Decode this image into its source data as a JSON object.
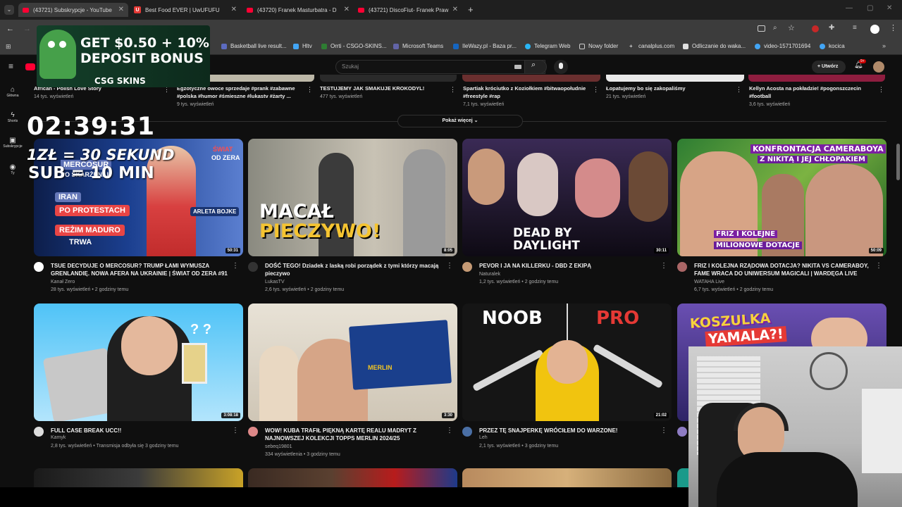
{
  "browser": {
    "tabs": [
      {
        "title": "(43721) Subskrypcje - YouTube"
      },
      {
        "title": "Best Food EVER | UwUFUFU",
        "icon_letter": "U"
      },
      {
        "title": "(43720) Franek Masturbatra - D"
      },
      {
        "title": "(43721) DiscoFiut- Franek Praw"
      }
    ],
    "new_tab": "+",
    "bookmarks": [
      {
        "label": "Basketball live result..."
      },
      {
        "label": "Hltv"
      },
      {
        "label": "Orrti - CSGO-SKINS..."
      },
      {
        "label": "Microsoft Teams"
      },
      {
        "label": "IleWazy.pl - Baza pr..."
      },
      {
        "label": "Telegram Web"
      },
      {
        "label": "Nowy folder"
      },
      {
        "label": "canalplus.com"
      },
      {
        "label": "Odliczanie do waka..."
      },
      {
        "label": "video-1571701694"
      },
      {
        "label": "kocica"
      }
    ]
  },
  "overlay": {
    "banner_line1": "GET $0.50 + 10%",
    "banner_line2": "DEPOSIT BONUS",
    "banner_brand": "CSG SKINS",
    "timer": "02:39:31",
    "line1": "1ZŁ = 30 SEKUND",
    "line2": "SUB = 10 MIN"
  },
  "youtube": {
    "search_placeholder": "Szukaj",
    "create_label": "Utwórz",
    "notif_count": "9+",
    "sidebar": [
      {
        "label": "Główna"
      },
      {
        "label": "Shorts"
      },
      {
        "label": "Subskrypcje"
      },
      {
        "label": "Ty"
      }
    ],
    "top_row": [
      {
        "title": "African - Polish Love Story",
        "stats": "14 tys. wyświetleń"
      },
      {
        "title": "Egzotyczne owoce sprzedaje #prank #zabawne #polska #humor #śmieszne #lukastv #żarty ...",
        "stats": "9 tys. wyświetleń"
      },
      {
        "title": "TESTUJEMY JAK SMAKUJE KROKODYL!",
        "stats": "477 tys. wyświetleń"
      },
      {
        "title": "Spartiak króciutko z Koziołkiem #bitwaopołudnie #freestyle #rap",
        "stats": "7,1 tys. wyświetleń"
      },
      {
        "title": "Łopatujemy bo się zakopaliśmy",
        "stats": "21 tys. wyświetleń"
      },
      {
        "title": "Kellyn Acosta na pokładzie! #pogonszczecin #football",
        "stats": "3,6 tys. wyświetleń"
      }
    ],
    "show_more": "Pokaż więcej",
    "videos": [
      {
        "title": "TSUE DECYDUJE O MERCOSUR? TRUMP ŁAMI WYMUSZA GRENLANDIĘ. NOWA AFERA NA UKRAINIE | ŚWIAT OD ZERA #91",
        "channel": "Kanał Zero",
        "stats": "28 tys. wyświetleń • 2 godziny temu",
        "duration": "50:31",
        "thumb_text": [
          "MERCOSUR",
          "PO SKARŻENIU",
          "IRAN",
          "PO PROTESTACH",
          "REŻIM MADURO",
          "TRWA",
          "ARLETA BOJKE",
          "ŚWIAT",
          "OD ZERA"
        ]
      },
      {
        "title": "DOŚĆ TEGO! Dziadek z laską robi porządek z tymi którzy macają pieczywo",
        "channel": "LukasTV",
        "stats": "2,6 tys. wyświetleń • 2 godziny temu",
        "duration": "8:05",
        "thumb_text": [
          "MACAŁ",
          "PIECZYWO!"
        ]
      },
      {
        "title": "PEVOR I JA NA KILLERKU - DBD Z EKIPĄ",
        "channel": "Naturalek",
        "stats": "1,2 tys. wyświetleń • 2 godziny temu",
        "duration": "30:11",
        "thumb_text": [
          "DEAD BY",
          "DAYLIGHT"
        ]
      },
      {
        "title": "FRIZ I KOLEJNA RZĄDOWA DOTACJA? NIKITA VS CAMERABOY, FAME WRACA DO UNIWERSUM MAGICALI | WARDĘGA LIVE",
        "channel": "WATAHA Live",
        "stats": "6,7 tys. wyświetleń • 2 godziny temu",
        "duration": "50:09",
        "thumb_text": [
          "KONFRONTACJA CAMERABOYA",
          "Z NIKITĄ I JEJ CHŁOPAKIEM",
          "FRIZ I KOLEJNE",
          "MILIONOWE DOTACJE"
        ]
      },
      {
        "title": "FULL CASE BREAK UCC!!",
        "channel": "Kamyk",
        "stats": "2,8 tys. wyświetleń • Transmisja odbyła się 3 godziny temu",
        "duration": "3:08:18",
        "thumb_text": []
      },
      {
        "title": "WOW! KUBA TRAFIŁ PIĘKNĄ KARTĘ REALU MADRYT Z NAJNOWSZEJ KOLEKCJI TOPPS MERLIN 2024/25",
        "channel": "sebeq19801",
        "stats": "334 wyświetlenia • 3 godziny temu",
        "duration": "3:30",
        "thumb_text": [
          "MERLIN"
        ]
      },
      {
        "title": "PRZEZ TĘ SNAJPERKĘ WRÓCIŁEM DO WARZONE!",
        "channel": "Leh",
        "stats": "2,1 tys. wyświetleń • 3 godziny temu",
        "duration": "21:02",
        "thumb_text": [
          "NOOB",
          "PRO"
        ]
      },
      {
        "title": "",
        "channel": "",
        "stats": "",
        "duration": "",
        "thumb_text": [
          "KOSZULKA",
          "YAMALA?!"
        ]
      }
    ]
  },
  "colors": {
    "yt_bg": "#0f0f0f",
    "red": "#ff0033",
    "text_secondary": "#aaaaaa",
    "banner_green": "#2bb673"
  }
}
